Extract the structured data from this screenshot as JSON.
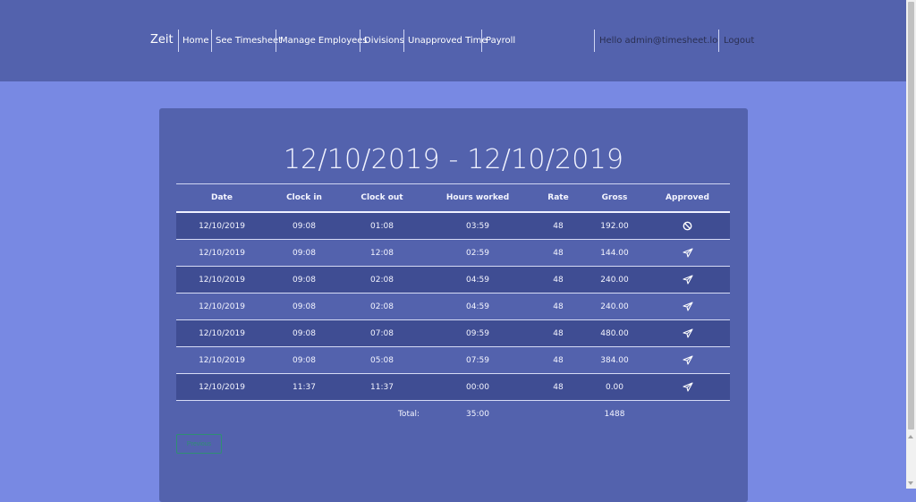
{
  "nav": {
    "brand": "Zeit",
    "items": [
      "Home",
      "See Timesheet",
      "Manage Employees",
      "Divisions",
      "Unapproved Time",
      "Payroll"
    ],
    "greeting": "Hello admin@timesheet.local!",
    "logout": "Logout"
  },
  "main": {
    "title": "12/10/2019 - 12/10/2019",
    "columns": [
      "Date",
      "Clock in",
      "Clock out",
      "Hours worked",
      "Rate",
      "Gross",
      "Approved"
    ],
    "rows": [
      {
        "date": "12/10/2019",
        "clock_in": "09:08",
        "clock_out": "01:08",
        "hours": "03:59",
        "rate": "48",
        "gross": "192.00",
        "approved_icon": "ban-icon"
      },
      {
        "date": "12/10/2019",
        "clock_in": "09:08",
        "clock_out": "12:08",
        "hours": "02:59",
        "rate": "48",
        "gross": "144.00",
        "approved_icon": "paper-plane-icon"
      },
      {
        "date": "12/10/2019",
        "clock_in": "09:08",
        "clock_out": "02:08",
        "hours": "04:59",
        "rate": "48",
        "gross": "240.00",
        "approved_icon": "paper-plane-icon"
      },
      {
        "date": "12/10/2019",
        "clock_in": "09:08",
        "clock_out": "02:08",
        "hours": "04:59",
        "rate": "48",
        "gross": "240.00",
        "approved_icon": "paper-plane-icon"
      },
      {
        "date": "12/10/2019",
        "clock_in": "09:08",
        "clock_out": "07:08",
        "hours": "09:59",
        "rate": "48",
        "gross": "480.00",
        "approved_icon": "paper-plane-icon"
      },
      {
        "date": "12/10/2019",
        "clock_in": "09:08",
        "clock_out": "05:08",
        "hours": "07:59",
        "rate": "48",
        "gross": "384.00",
        "approved_icon": "paper-plane-icon"
      },
      {
        "date": "12/10/2019",
        "clock_in": "11:37",
        "clock_out": "11:37",
        "hours": "00:00",
        "rate": "48",
        "gross": "0.00",
        "approved_icon": "paper-plane-icon"
      }
    ],
    "total_label": "Total:",
    "total_hours": "35:00",
    "total_gross": "1488",
    "previous_button": "Previous"
  },
  "colors": {
    "page_bg": "#7889e3",
    "navbar_bg": "#5362ad",
    "card_bg": "#5362ad",
    "row_dark_bg": "#3f4d93",
    "button_accent": "#2f8f73"
  }
}
